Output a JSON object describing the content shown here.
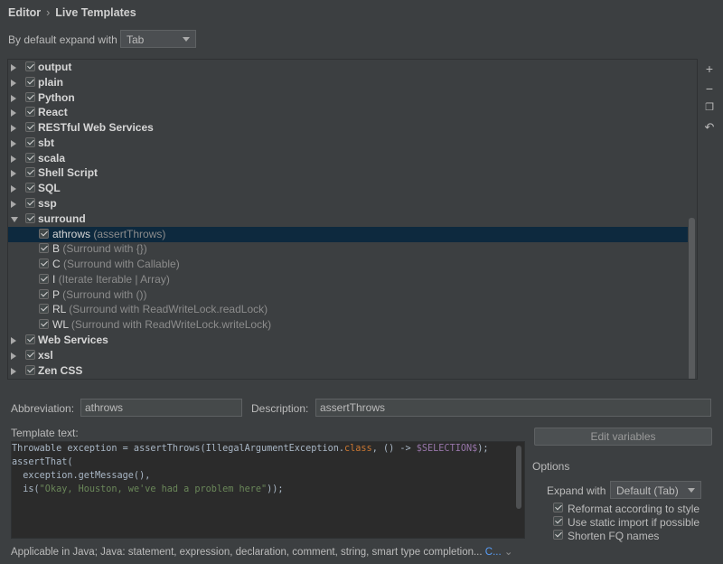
{
  "breadcrumb": {
    "root": "Editor",
    "current": "Live Templates"
  },
  "expand": {
    "label": "By default expand with",
    "value": "Tab"
  },
  "groups_top": [
    {
      "name": "output"
    },
    {
      "name": "plain"
    },
    {
      "name": "Python"
    },
    {
      "name": "React"
    },
    {
      "name": "RESTful Web Services"
    },
    {
      "name": "sbt"
    },
    {
      "name": "scala"
    },
    {
      "name": "Shell Script"
    },
    {
      "name": "SQL"
    },
    {
      "name": "ssp"
    }
  ],
  "expanded_group": {
    "name": "surround"
  },
  "templates": [
    {
      "abbr": "athrows",
      "desc": "(assertThrows)"
    },
    {
      "abbr": "B",
      "desc": "(Surround with {})"
    },
    {
      "abbr": "C",
      "desc": "(Surround with Callable)"
    },
    {
      "abbr": "I",
      "desc": "(Iterate Iterable | Array)"
    },
    {
      "abbr": "P",
      "desc": "(Surround with ())"
    },
    {
      "abbr": "RL",
      "desc": "(Surround with ReadWriteLock.readLock)"
    },
    {
      "abbr": "WL",
      "desc": "(Surround with ReadWriteLock.writeLock)"
    }
  ],
  "groups_bottom": [
    {
      "name": "Web Services"
    },
    {
      "name": "xsl"
    },
    {
      "name": "Zen CSS"
    }
  ],
  "toolbar_icons": [
    "add-icon",
    "remove-icon",
    "copy-icon",
    "restore-icon"
  ],
  "abbreviation": {
    "label": "Abbreviation:",
    "value": "athrows"
  },
  "description": {
    "label": "Description:",
    "value": "assertThrows"
  },
  "template_text_label": "Template text:",
  "code": {
    "l1a": "Throwable exception = assertThrows(IllegalArgumentException.",
    "l1kw": "class",
    "l1b": ", () -> ",
    "l1var": "$SELECTION$",
    "l1c": ");",
    "l2": "assertThat(",
    "l3": "  exception.getMessage(),",
    "l4a": "  is(",
    "l4str": "\"Okay, Houston, we've had a problem here\"",
    "l4b": "));"
  },
  "edit_variables": "Edit variables",
  "options": {
    "title": "Options",
    "expand_label": "Expand with",
    "expand_value": "Default (Tab)",
    "reformat": "Reformat according to style",
    "static_import": "Use static import if possible",
    "shorten": "Shorten FQ names"
  },
  "applicable": {
    "text": "Applicable in Java; Java: statement, expression, declaration, comment, string, smart type completion...",
    "link": "C..."
  }
}
